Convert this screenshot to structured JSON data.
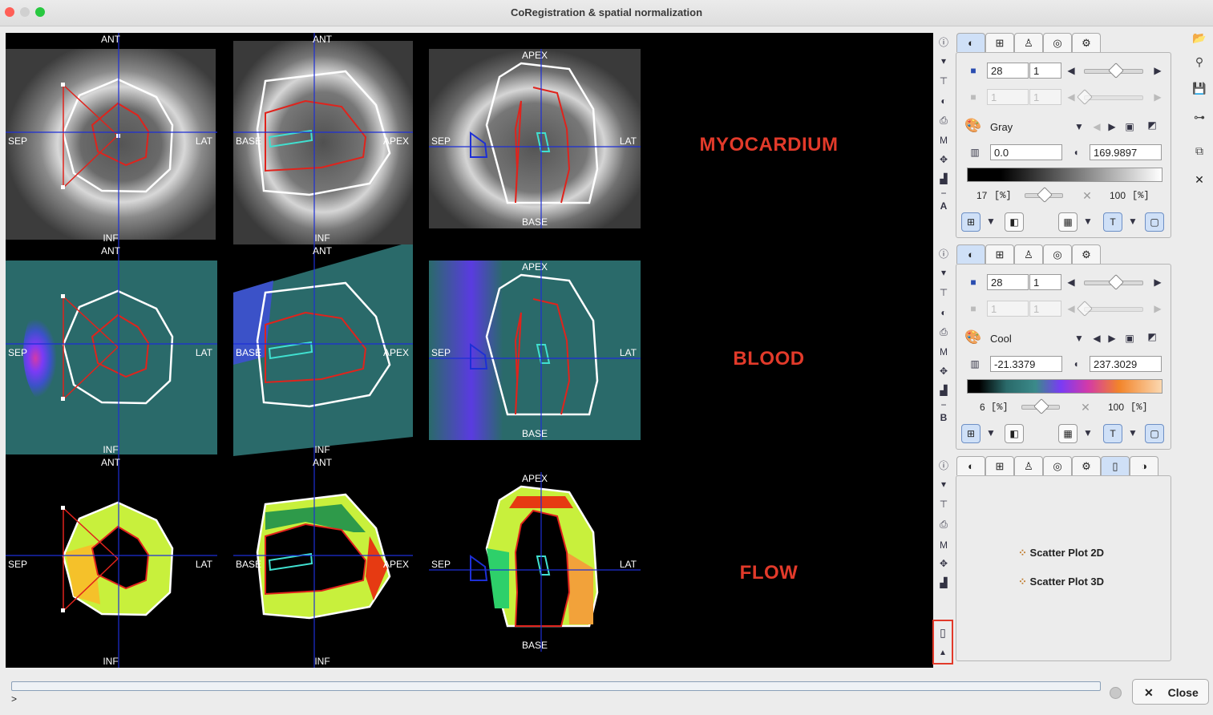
{
  "window": {
    "title": "CoRegistration & spatial normalization"
  },
  "orientation": {
    "ant": "ANT",
    "inf": "INF",
    "sep": "SEP",
    "lat": "LAT",
    "base": "BASE",
    "apex": "APEX"
  },
  "rows": [
    {
      "label": "MYOCARDIUM",
      "colormap": "gray"
    },
    {
      "label": "BLOOD",
      "colormap": "cool"
    },
    {
      "label": "FLOW",
      "colormap": "flow"
    }
  ],
  "panel_a": {
    "slice": "28",
    "step": "1",
    "slice2": "1",
    "step2": "1",
    "lut": "Gray",
    "min": "0.0",
    "max": "169.9897",
    "lower_pct": "17",
    "upper_pct": "100",
    "unit": "[%]",
    "letter": "A"
  },
  "panel_b": {
    "slice": "28",
    "step": "1",
    "slice2": "1",
    "step2": "1",
    "lut": "Cool",
    "min": "-21.3379",
    "max": "237.3029",
    "lower_pct": "6",
    "upper_pct": "100",
    "unit": "[%]",
    "letter": "B"
  },
  "panel_c": {
    "scatter2d": "Scatter Plot 2D",
    "scatter3d": "Scatter Plot 3D"
  },
  "footer": {
    "prompt": ">",
    "close": "Close"
  },
  "colors": {
    "roi_outer": "#ffffff",
    "roi_inner": "#e0231c",
    "roi_cyan": "#40e0d0",
    "crosshair": "#1d2fd6",
    "label_red": "#e23a2a"
  }
}
